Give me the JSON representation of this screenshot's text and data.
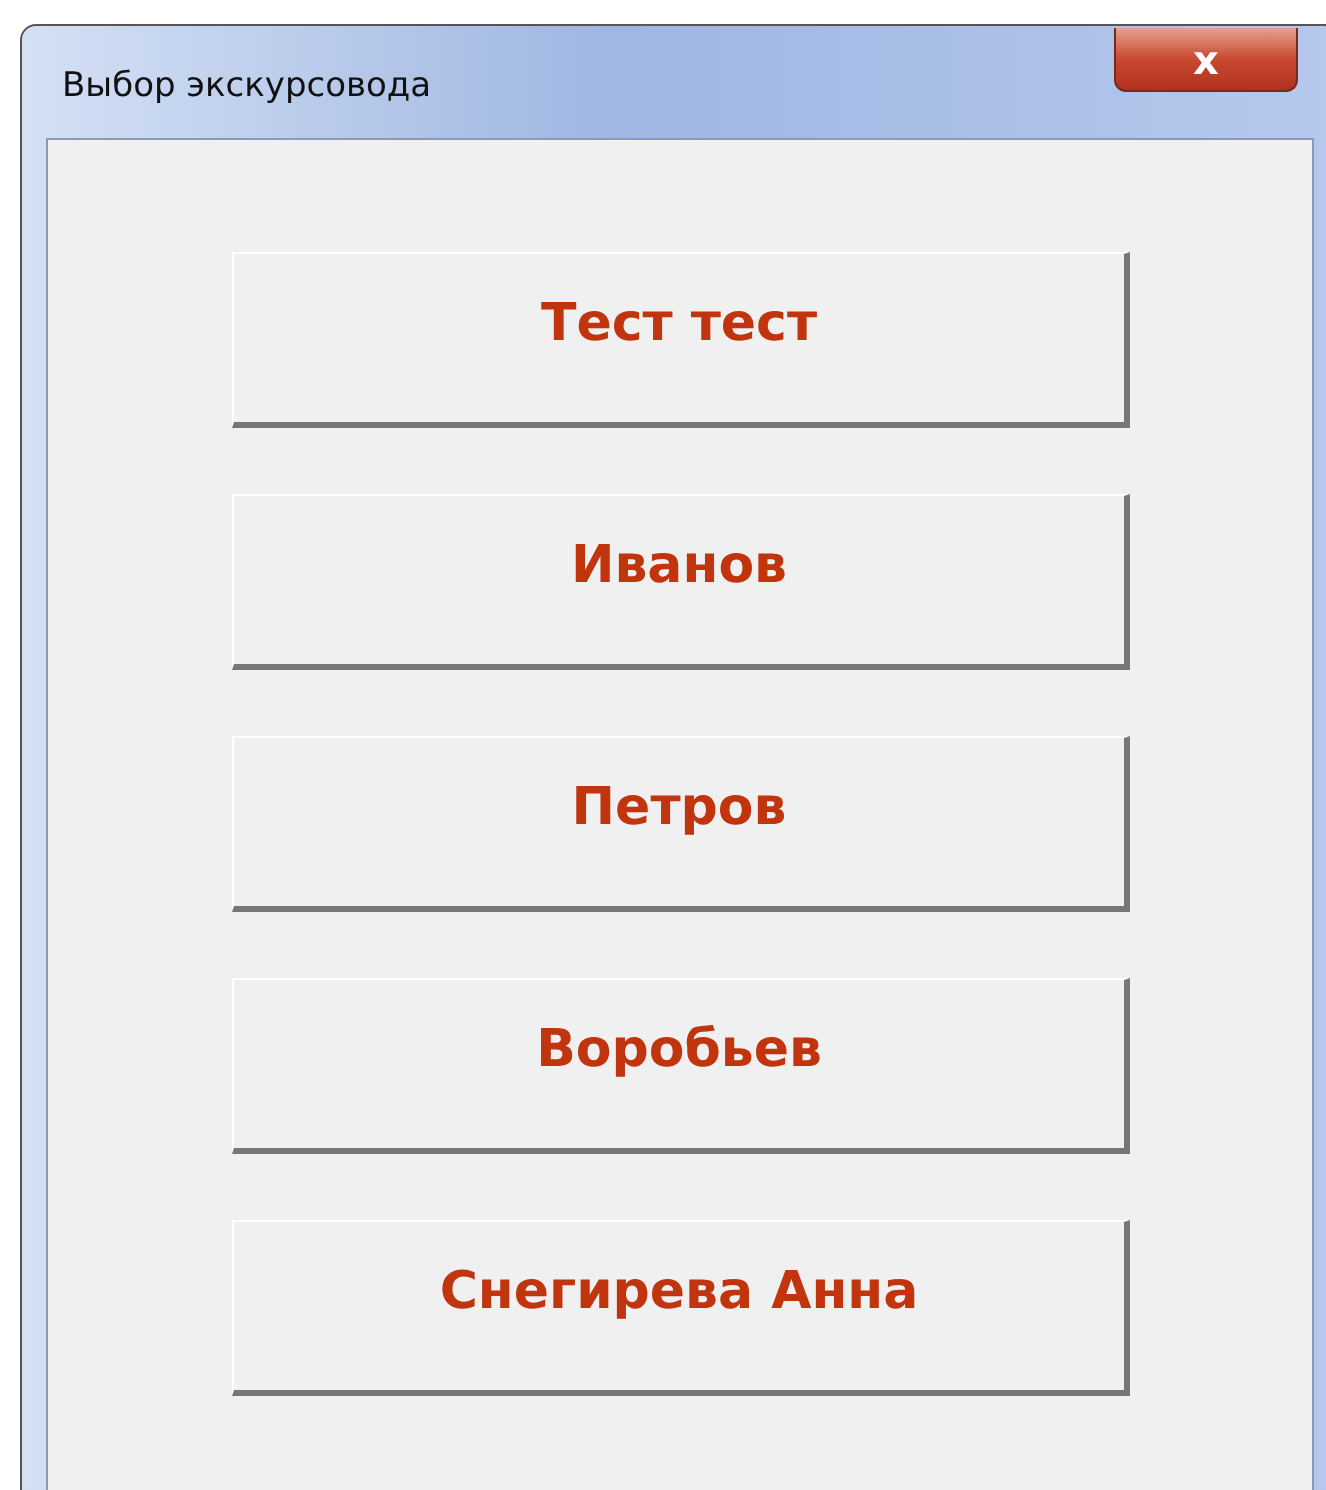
{
  "window": {
    "title": "Выбор экскурсовода",
    "close_button": "x"
  },
  "buttons": [
    {
      "label": "Тест тест"
    },
    {
      "label": "Иванов"
    },
    {
      "label": "Петров"
    },
    {
      "label": "Воробьев"
    },
    {
      "label": "Снегирева Анна"
    }
  ]
}
